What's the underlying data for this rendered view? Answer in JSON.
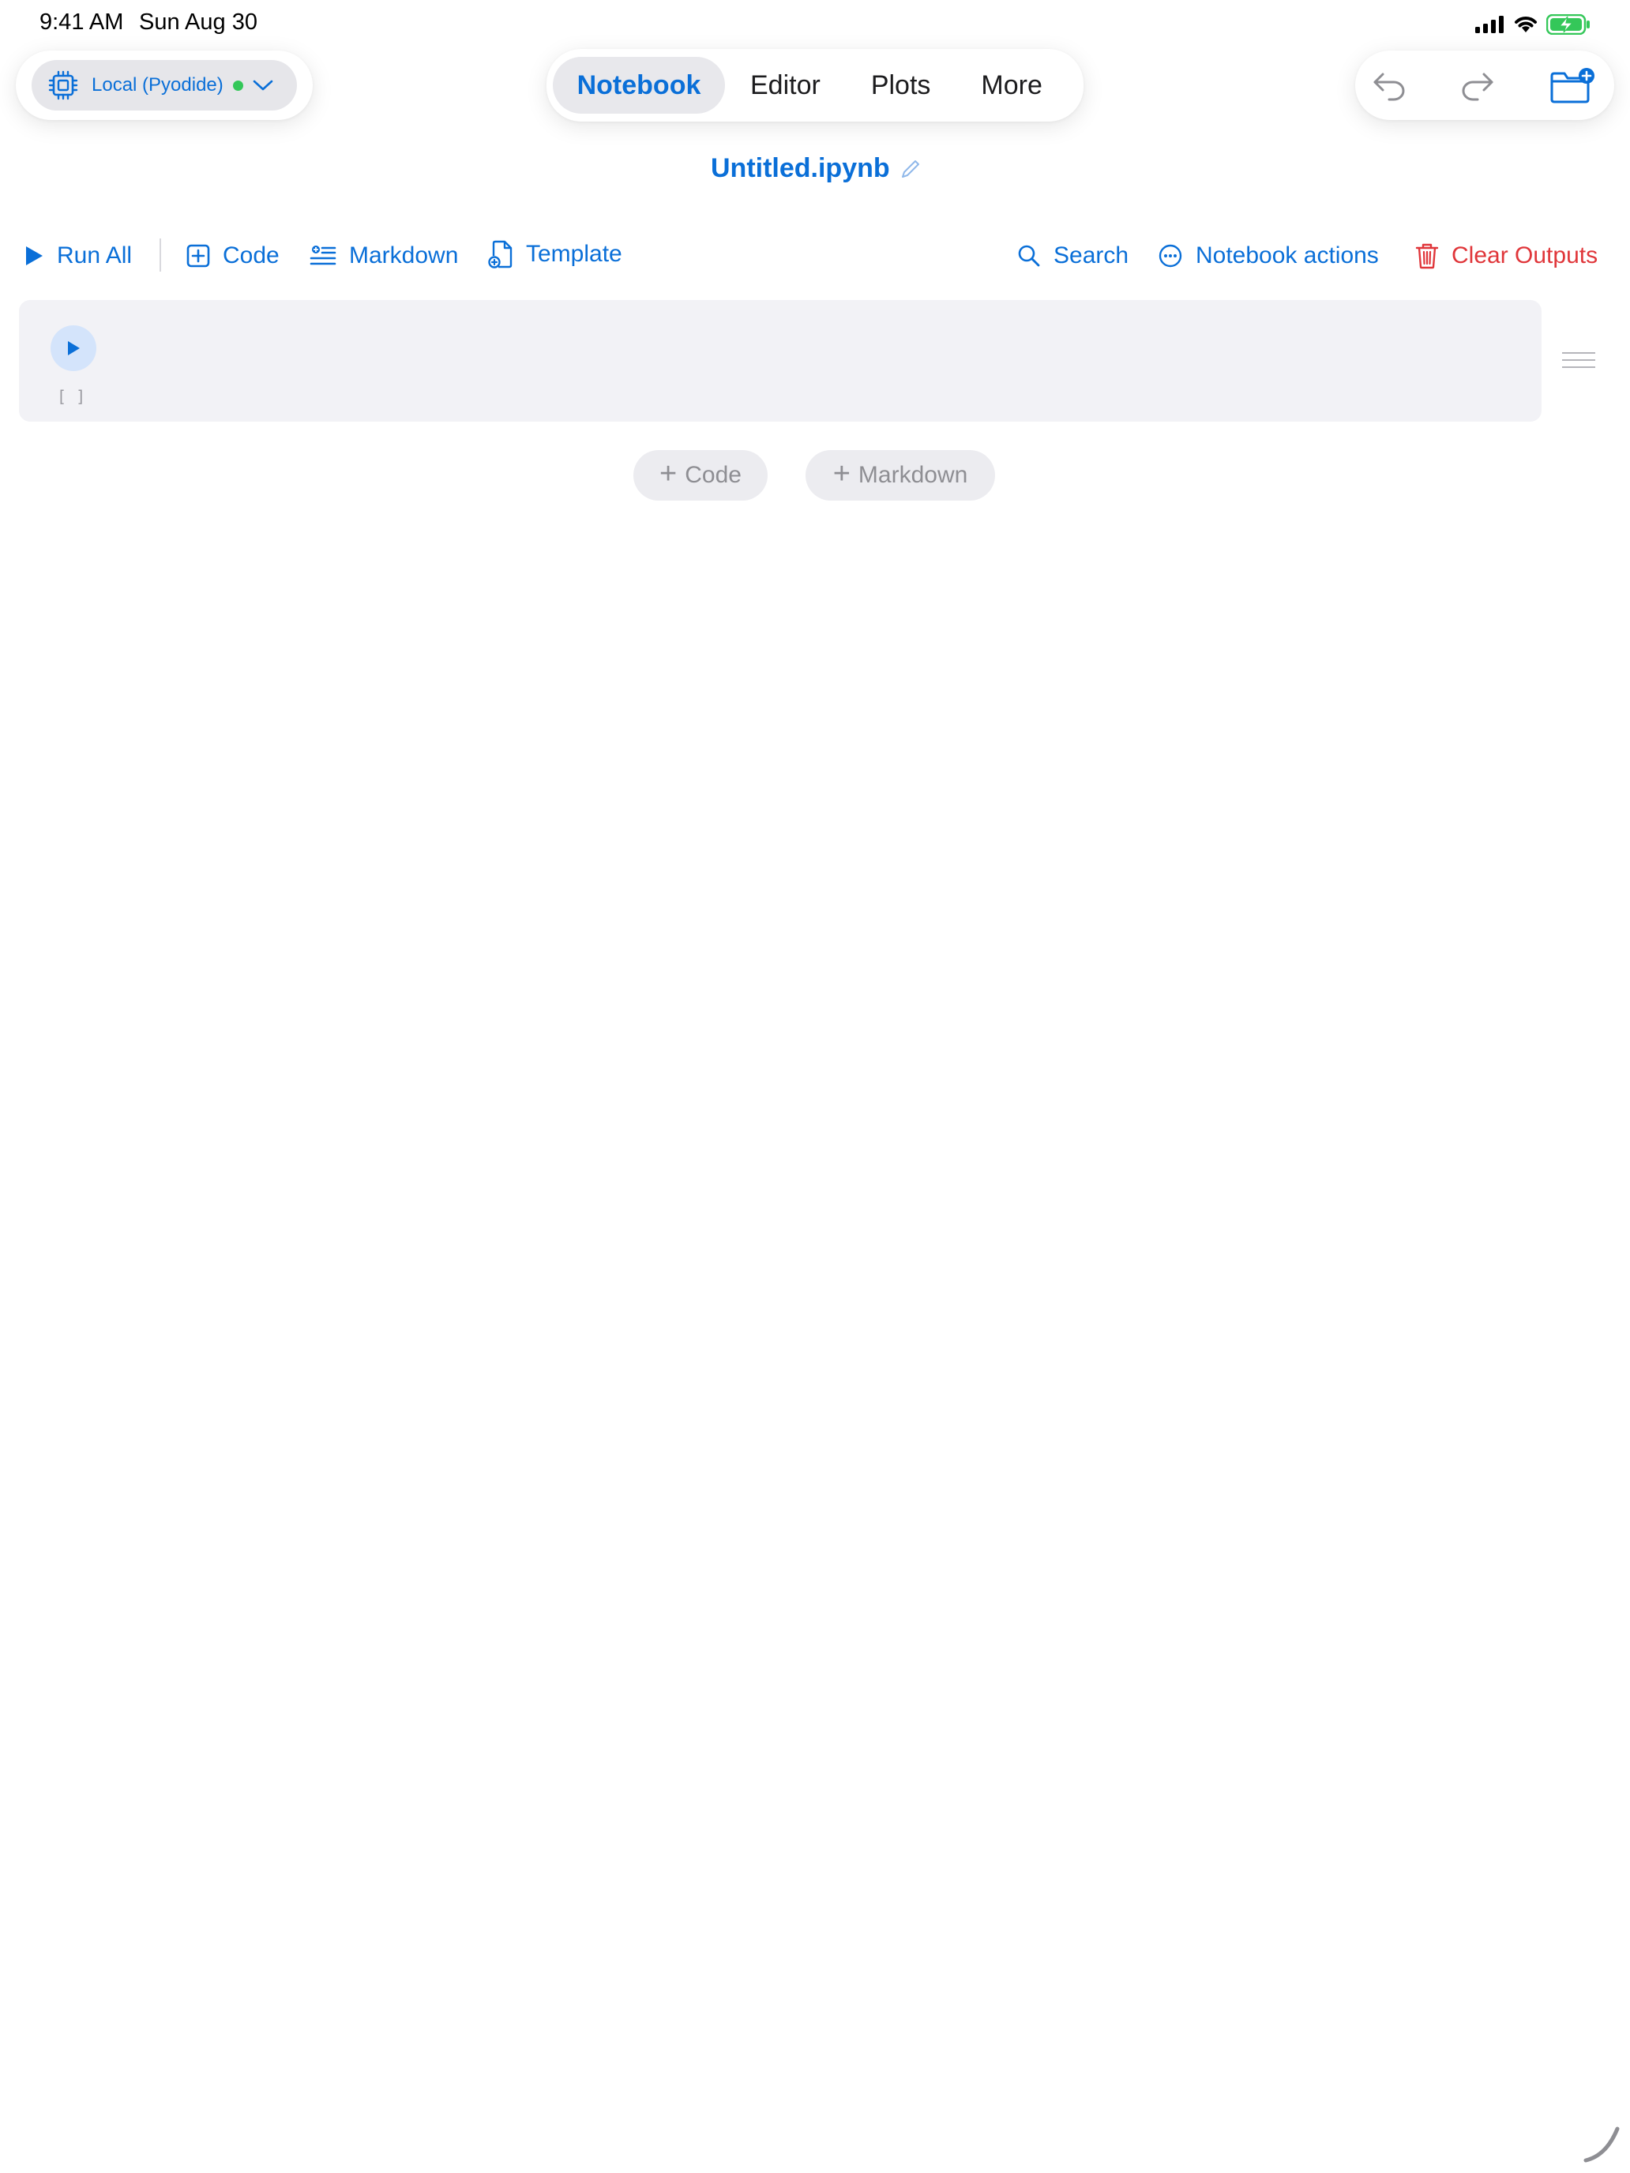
{
  "status_bar": {
    "time": "9:41 AM",
    "date": "Sun Aug 30"
  },
  "kernel": {
    "label": "Local (Pyodide)",
    "status_color": "#34c759"
  },
  "tabs": [
    {
      "label": "Notebook",
      "active": true
    },
    {
      "label": "Editor",
      "active": false
    },
    {
      "label": "Plots",
      "active": false
    },
    {
      "label": "More",
      "active": false
    }
  ],
  "document": {
    "title": "Untitled.ipynb"
  },
  "toolbar": {
    "run_all": "Run All",
    "code": "Code",
    "markdown": "Markdown",
    "template": "Template",
    "search": "Search",
    "notebook_actions": "Notebook actions",
    "clear_outputs": "Clear Outputs"
  },
  "cell": {
    "execution_count": "[ ]"
  },
  "add_cell": {
    "code": "Code",
    "markdown": "Markdown"
  },
  "colors": {
    "accent": "#0a6fd8",
    "danger": "#e0363a",
    "cell_background": "#f2f2f6"
  }
}
